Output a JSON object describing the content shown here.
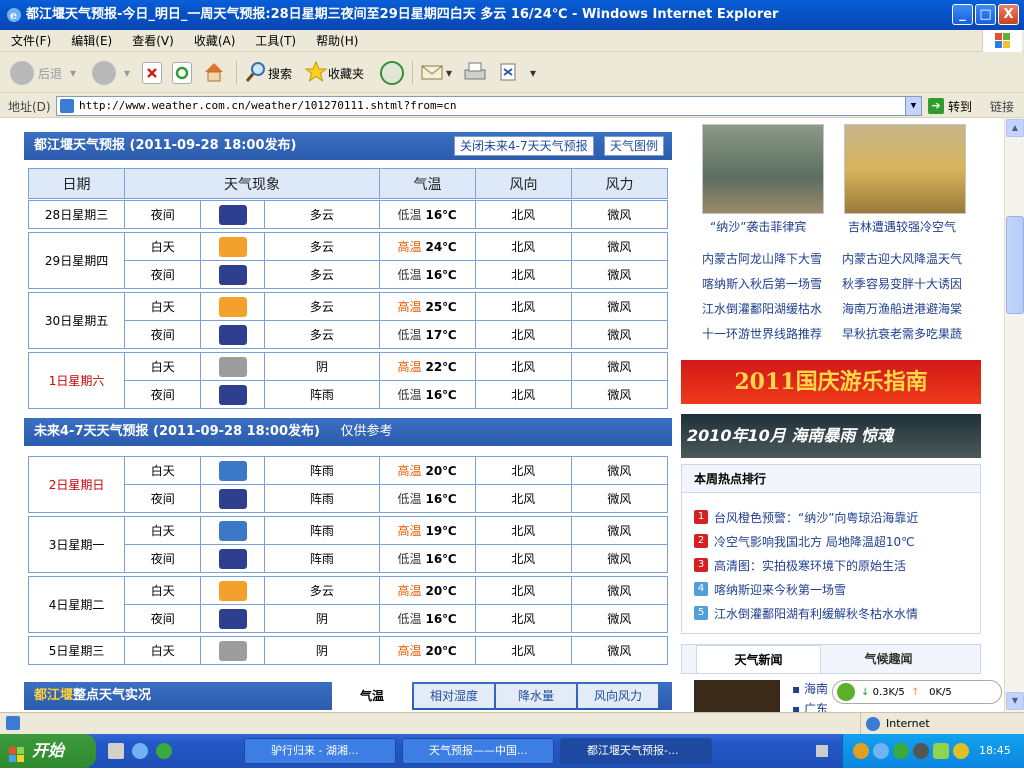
{
  "window": {
    "title": "都江堰天气预报-今日_明日_一周天气预报:28日星期三夜间至29日星期四白天 多云 16/24℃ - Windows Internet Explorer",
    "min": "_",
    "max": "□",
    "close": "X"
  },
  "menu": [
    "文件(F)",
    "编辑(E)",
    "查看(V)",
    "收藏(A)",
    "工具(T)",
    "帮助(H)"
  ],
  "toolbar": {
    "back": "后退",
    "search": "搜索",
    "favorites": "收藏夹"
  },
  "address": {
    "label": "地址(D)",
    "url": "http://www.weather.com.cn/weather/101270111.shtml?from=cn",
    "go": "转到",
    "links": "链接"
  },
  "forecast": {
    "title": "都江堰天气预报 (2011-09-28 18:00发布)",
    "close_btn": "关闭未来4-7天天气预报",
    "legend_btn": "天气图例",
    "headers": [
      "日期",
      "天气现象",
      "气温",
      "风向",
      "风力"
    ],
    "days": [
      {
        "date": "28日星期三",
        "rows": [
          {
            "period": "夜间",
            "icon": "night-cloudy",
            "weather": "多云",
            "tlabel": "低温",
            "temp": "16℃",
            "wind": "北风",
            "force": "微风"
          }
        ]
      },
      {
        "date": "29日星期四",
        "rows": [
          {
            "period": "白天",
            "icon": "day-cloudy",
            "weather": "多云",
            "tlabel": "高温",
            "temp": "24℃",
            "wind": "北风",
            "force": "微风"
          },
          {
            "period": "夜间",
            "icon": "night-cloudy",
            "weather": "多云",
            "tlabel": "低温",
            "temp": "16℃",
            "wind": "北风",
            "force": "微风"
          }
        ]
      },
      {
        "date": "30日星期五",
        "rows": [
          {
            "period": "白天",
            "icon": "day-cloudy",
            "weather": "多云",
            "tlabel": "高温",
            "temp": "25℃",
            "wind": "北风",
            "force": "微风"
          },
          {
            "period": "夜间",
            "icon": "night-cloudy",
            "weather": "多云",
            "tlabel": "低温",
            "temp": "17℃",
            "wind": "北风",
            "force": "微风"
          }
        ]
      },
      {
        "date": "1日星期六",
        "red": true,
        "rows": [
          {
            "period": "白天",
            "icon": "overcast",
            "weather": "阴",
            "tlabel": "高温",
            "temp": "22℃",
            "wind": "北风",
            "force": "微风"
          },
          {
            "period": "夜间",
            "icon": "night-shower",
            "weather": "阵雨",
            "tlabel": "低温",
            "temp": "16℃",
            "wind": "北风",
            "force": "微风"
          }
        ]
      }
    ]
  },
  "extended": {
    "title": "未来4-7天天气预报 (2011-09-28 18:00发布)",
    "note": "仅供参考",
    "days": [
      {
        "date": "2日星期日",
        "red": true,
        "rows": [
          {
            "period": "白天",
            "icon": "day-shower",
            "weather": "阵雨",
            "tlabel": "高温",
            "temp": "20℃",
            "wind": "北风",
            "force": "微风"
          },
          {
            "period": "夜间",
            "icon": "night-shower",
            "weather": "阵雨",
            "tlabel": "低温",
            "temp": "16℃",
            "wind": "北风",
            "force": "微风"
          }
        ]
      },
      {
        "date": "3日星期一",
        "rows": [
          {
            "period": "白天",
            "icon": "day-shower",
            "weather": "阵雨",
            "tlabel": "高温",
            "temp": "19℃",
            "wind": "北风",
            "force": "微风"
          },
          {
            "period": "夜间",
            "icon": "night-shower",
            "weather": "阵雨",
            "tlabel": "低温",
            "temp": "16℃",
            "wind": "北风",
            "force": "微风"
          }
        ]
      },
      {
        "date": "4日星期二",
        "rows": [
          {
            "period": "白天",
            "icon": "day-cloudy",
            "weather": "多云",
            "tlabel": "高温",
            "temp": "20℃",
            "wind": "北风",
            "force": "微风"
          },
          {
            "period": "夜间",
            "icon": "night-overcast",
            "weather": "阴",
            "tlabel": "低温",
            "temp": "16℃",
            "wind": "北风",
            "force": "微风"
          }
        ]
      },
      {
        "date": "5日星期三",
        "rows": [
          {
            "period": "白天",
            "icon": "overcast",
            "weather": "阴",
            "tlabel": "高温",
            "temp": "20℃",
            "wind": "北风",
            "force": "微风"
          }
        ]
      }
    ]
  },
  "live": {
    "city": "都江堰",
    "title": "整点天气实况",
    "tabs": [
      "气温",
      "相对湿度",
      "降水量",
      "风向风力"
    ]
  },
  "sidebar": {
    "photos": [
      {
        "caption": "“纳沙”袭击菲律宾"
      },
      {
        "caption": "吉林遭遇较强冷空气"
      }
    ],
    "links": [
      [
        "内蒙古阿龙山降下大雪",
        "内蒙古迎大风降温天气"
      ],
      [
        "喀纳斯入秋后第一场雪",
        "秋季容易变胖十大诱因"
      ],
      [
        "江水倒灌鄱阳湖缓枯水",
        "海南万渔船进港避海棠"
      ],
      [
        "十一环游世界线路推荐",
        "早秋抗衰老需多吃果蔬"
      ]
    ],
    "banner1": "2011国庆游乐指南",
    "banner2": "2010年10月 海南暴雨 惊魂",
    "hot_title": "本周热点排行",
    "hot": [
      "台风橙色预警：“纳沙”向粤琼沿海靠近",
      "冷空气影响我国北方 局地降温超10℃",
      "高清图：实拍极寒环境下的原始生活",
      "喀纳斯迎来今秋第一场雪",
      "江水倒灌鄱阳湖有利缓解秋冬枯水水情"
    ],
    "tab_news": "天气新闻",
    "tab_fun": "气候趣闻",
    "news_items": [
      "海南",
      "广东"
    ]
  },
  "status": {
    "zone": "Internet",
    "net_down": "0.3K/5",
    "net_up": "0K/5"
  },
  "taskbar": {
    "start": "开始",
    "tasks": [
      "驴行归来 - 湖湘...",
      "天气预报——中国...",
      "都江堰天气预报-..."
    ],
    "clock": "18:45"
  }
}
